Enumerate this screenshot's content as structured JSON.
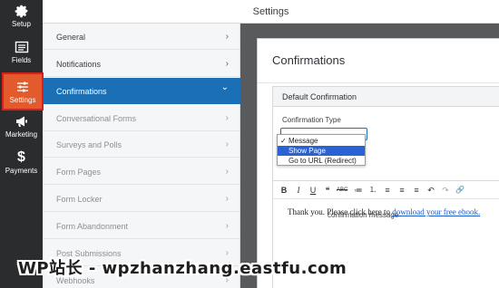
{
  "rail": {
    "items": [
      {
        "label": "Setup",
        "icon": "gear-icon"
      },
      {
        "label": "Fields",
        "icon": "fields-icon"
      },
      {
        "label": "Settings",
        "icon": "sliders-icon"
      },
      {
        "label": "Marketing",
        "icon": "megaphone-icon"
      },
      {
        "label": "Payments",
        "icon": "dollar-icon"
      }
    ],
    "active_color": "#e35b2c"
  },
  "header": {
    "title": "Settings"
  },
  "nav": {
    "items": [
      {
        "label": "General"
      },
      {
        "label": "Notifications"
      },
      {
        "label": "Confirmations"
      },
      {
        "label": "Conversational Forms"
      },
      {
        "label": "Surveys and Polls"
      },
      {
        "label": "Form Pages"
      },
      {
        "label": "Form Locker"
      },
      {
        "label": "Form Abandonment"
      },
      {
        "label": "Post Submissions"
      },
      {
        "label": "Webhooks"
      }
    ],
    "chevron_right": "›",
    "chevron_down": "⌄",
    "active_color": "#1a6fb5"
  },
  "panel": {
    "title": "Confirmations",
    "box_title": "Default Confirmation",
    "type_label": "Confirmation Type",
    "dropdown": {
      "options": [
        "Message",
        "Show Page",
        "Go to URL (Redirect)"
      ],
      "checked": "Message",
      "highlighted": "Show Page",
      "check_mark": "✓"
    },
    "toolbar": {
      "buttons": [
        "B",
        "I",
        "U",
        "❝",
        "ABC",
        "≔",
        "⒈",
        "≡",
        "≡",
        "≡",
        "↶",
        "↷",
        "🔗"
      ]
    },
    "content": {
      "text": "Thank you. Please click here to",
      "link": "download your free ebook."
    },
    "checkbox_label": "confirmation message"
  },
  "watermark": "WP站长 - wpzhanzhang.eastfu.com"
}
